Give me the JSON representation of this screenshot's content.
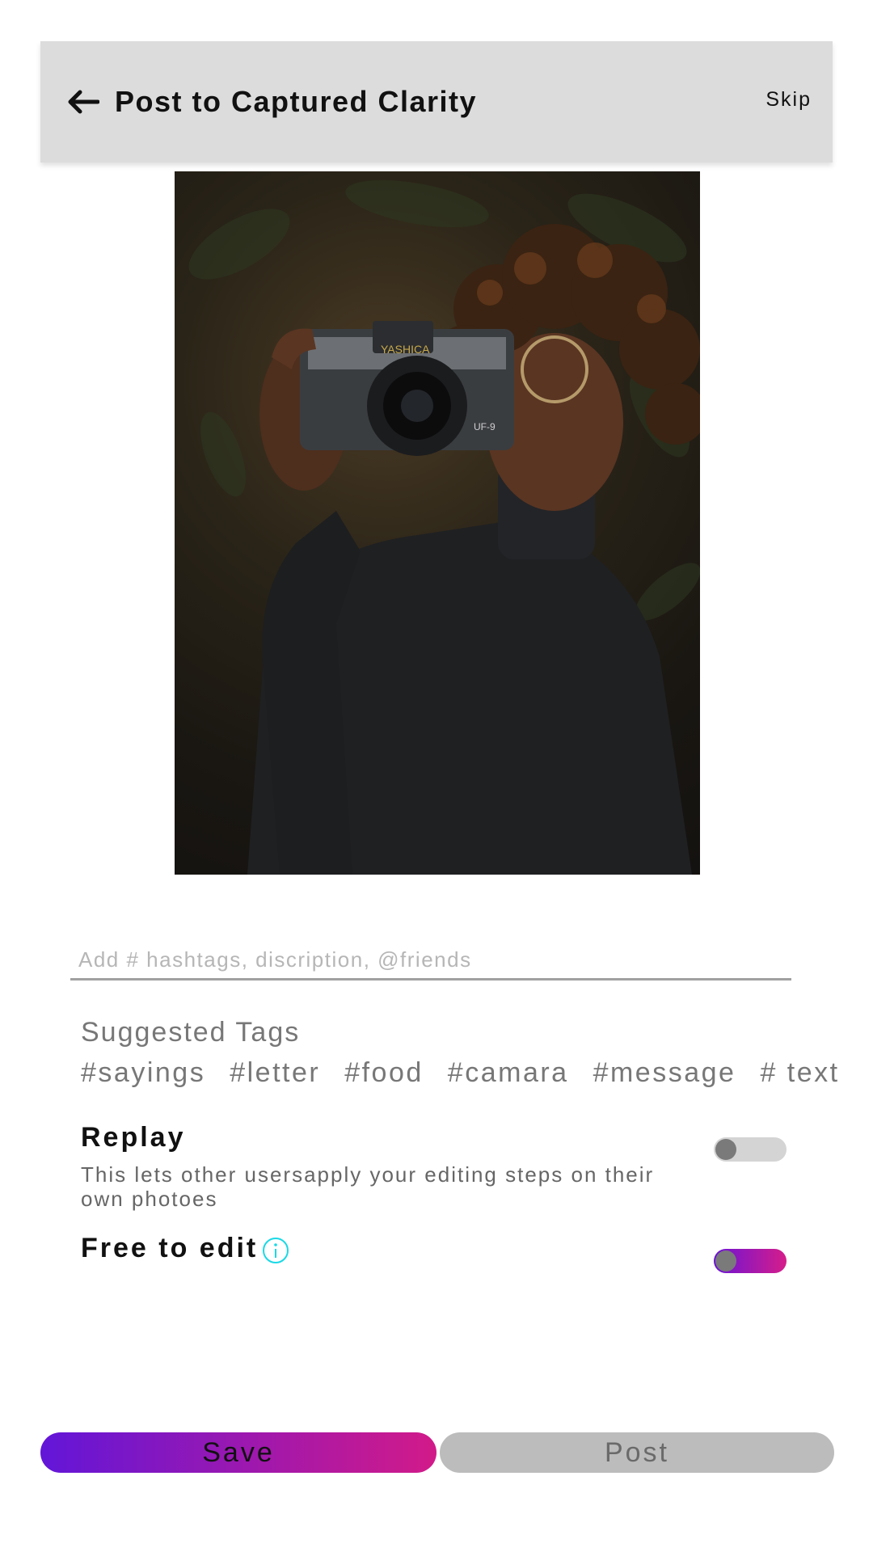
{
  "header": {
    "title": "Post to Captured Clarity",
    "skip_label": "Skip",
    "back_icon": "arrow-left-icon"
  },
  "photo": {
    "camera_brand": "YASHICA",
    "camera_model": "UF-9"
  },
  "caption": {
    "placeholder": "Add # hashtags, discription, @friends",
    "value": ""
  },
  "suggested": {
    "title": "Suggested Tags",
    "tags": [
      "#sayings",
      "#letter",
      "#food",
      "#camara",
      "#message",
      "# text"
    ]
  },
  "replay": {
    "label": "Replay",
    "description": "This lets other usersapply your editing steps on their own photoes",
    "enabled": false
  },
  "free_to_edit": {
    "label": "Free to edit",
    "info_icon": "info-icon",
    "enabled": true
  },
  "actions": {
    "save_label": "Save",
    "post_label": "Post"
  },
  "colors": {
    "header_bg": "#dcdcdc",
    "gradient_start": "#6216d8",
    "gradient_end": "#d21a89",
    "info_icon": "#19d9e6",
    "post_bg": "#bcbcbc"
  }
}
